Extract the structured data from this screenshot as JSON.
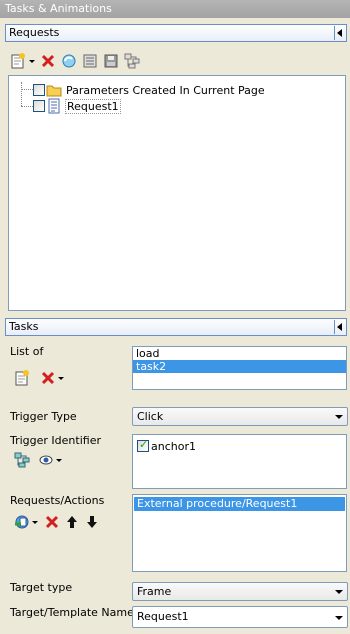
{
  "window": {
    "title": "Tasks & Animations"
  },
  "requests_panel": {
    "header": "Requests",
    "toolbar": [
      "new-request-icon",
      "delete-icon",
      "refresh-icon",
      "properties-icon",
      "save-icon",
      "hierarchy-icon"
    ],
    "tree": [
      {
        "label": "Parameters Created In Current Page",
        "icon": "folder-icon",
        "checked": false
      },
      {
        "label": "Request1",
        "icon": "document-icon",
        "checked": false
      }
    ]
  },
  "tasks_panel": {
    "header": "Tasks",
    "list_of_label": "List of",
    "tasks": [
      "load",
      "task2"
    ],
    "selected_task": "task2",
    "trigger_type_label": "Trigger Type",
    "trigger_type_value": "Click",
    "trigger_identifier_label": "Trigger Identifier",
    "trigger_identifiers": [
      {
        "label": "anchor1",
        "checked": true
      }
    ],
    "requests_actions_label": "Requests/Actions",
    "requests_actions": [
      "External procedure/Request1"
    ],
    "target_type_label": "Target type",
    "target_type_value": "Frame",
    "target_template_label": "Target/Template Name",
    "target_template_value": "Request1"
  },
  "colors": {
    "selection": "#3d95e5",
    "border": "#7f9db9",
    "accent_red": "#d21f1f"
  }
}
